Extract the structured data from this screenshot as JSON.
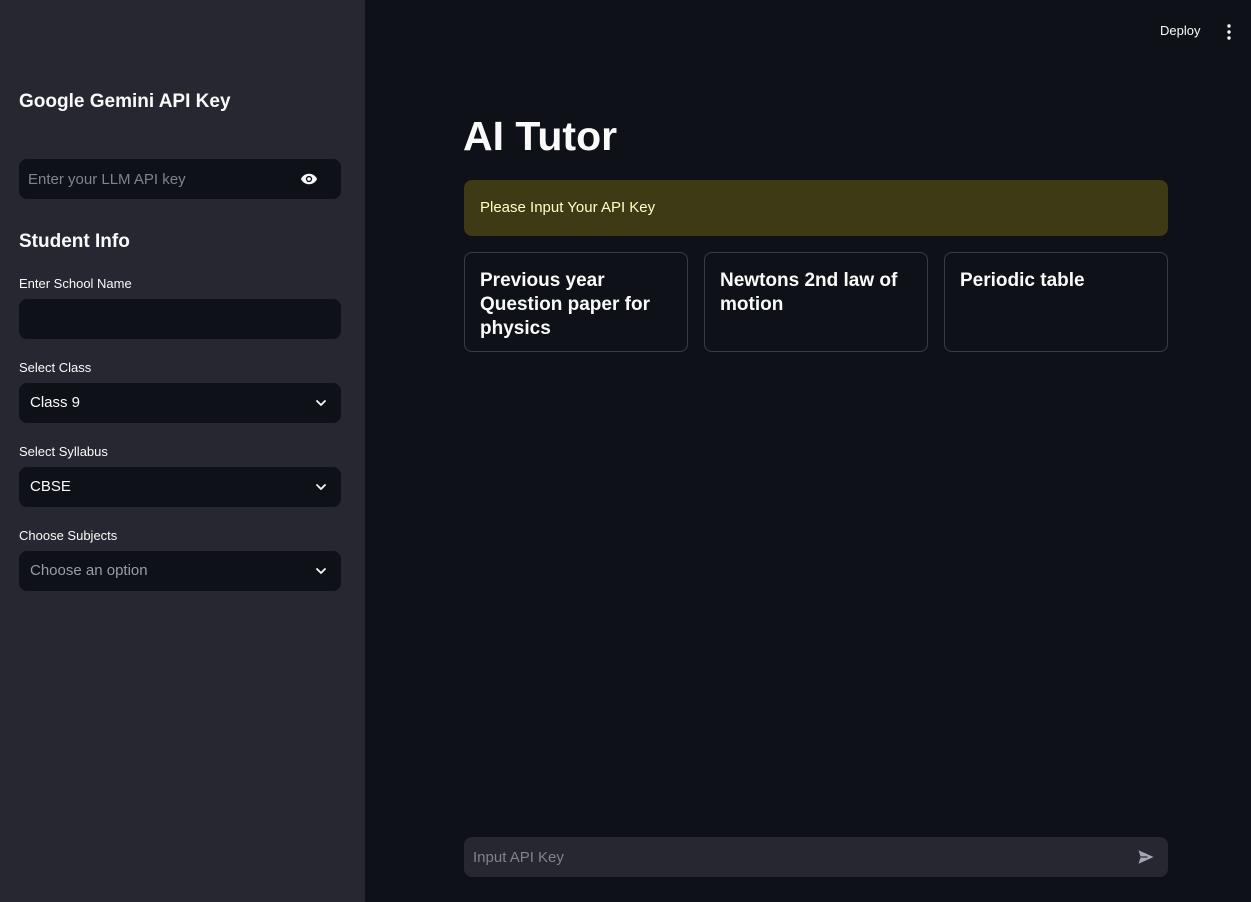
{
  "header": {
    "deploy_label": "Deploy",
    "menu_icon": "kebab-menu-icon"
  },
  "sidebar": {
    "api_section": {
      "heading": "Google Gemini API Key",
      "api_key_placeholder": "Enter your LLM API key",
      "api_key_value": "",
      "toggle_icon": "eye-icon"
    },
    "student_section": {
      "heading": "Student Info",
      "school": {
        "label": "Enter School Name",
        "value": ""
      },
      "class_select": {
        "label": "Select Class",
        "value": "Class 9"
      },
      "syllabus_select": {
        "label": "Select Syllabus",
        "value": "CBSE"
      },
      "subjects_select": {
        "label": "Choose Subjects",
        "placeholder": "Choose an option"
      }
    }
  },
  "main": {
    "title": "AI Tutor",
    "alert": {
      "text": "Please Input Your API Key",
      "color": "#3e3a16",
      "text_color": "#ffffc2"
    },
    "suggestions": [
      "Previous year Question paper for physics",
      "Newtons 2nd law of motion",
      "Periodic table"
    ],
    "chat_input": {
      "placeholder": "Input API Key",
      "value": "",
      "send_icon": "send-icon"
    }
  },
  "colors": {
    "app_bg": "#0e1117",
    "sidebar_bg": "#262730",
    "text": "#fafafa"
  }
}
